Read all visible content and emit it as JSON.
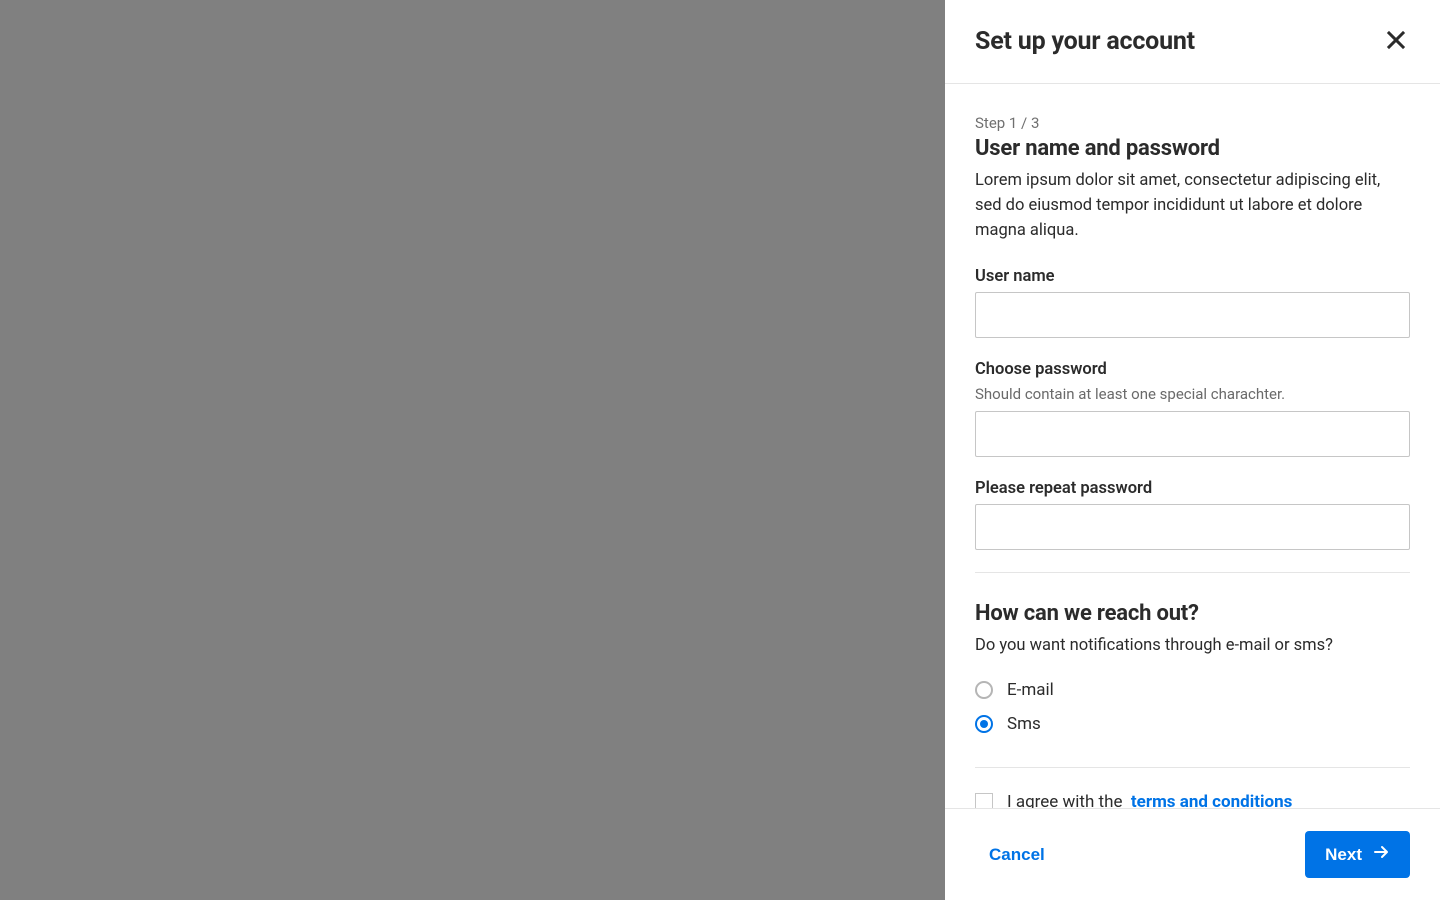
{
  "panel": {
    "title": "Set up your account",
    "step_indicator": "Step 1 / 3",
    "section1": {
      "heading": "User name and password",
      "description": "Lorem ipsum dolor sit amet, consectetur adipiscing elit, sed do eiusmod tempor incididunt ut labore et dolore magna aliqua."
    },
    "fields": {
      "username": {
        "label": "User name",
        "value": ""
      },
      "password": {
        "label": "Choose password",
        "hint": "Should contain at least one special charachter.",
        "value": ""
      },
      "repeat": {
        "label": "Please repeat password",
        "value": ""
      }
    },
    "section2": {
      "heading": "How can we reach out?",
      "description": "Do you want notifications through e-mail or sms?"
    },
    "contact_options": {
      "email": {
        "label": "E-mail",
        "selected": false
      },
      "sms": {
        "label": "Sms",
        "selected": true
      }
    },
    "agree": {
      "checked": false,
      "text_prefix": "I agree  with the",
      "link_text": "terms and conditions"
    },
    "footer": {
      "cancel_label": "Cancel",
      "next_label": "Next"
    }
  },
  "colors": {
    "primary": "#0073e6"
  }
}
